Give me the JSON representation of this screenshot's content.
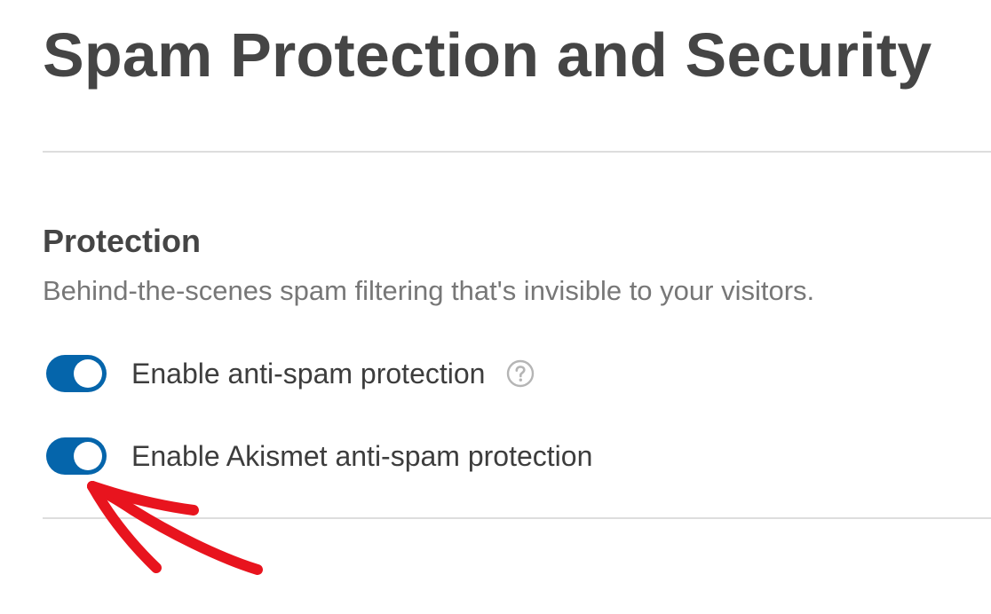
{
  "page": {
    "title": "Spam Protection and Security"
  },
  "protection": {
    "heading": "Protection",
    "description": "Behind-the-scenes spam filtering that's invisible to your visitors.",
    "settings": [
      {
        "label": "Enable anti-spam protection",
        "enabled": true,
        "help_icon": "question-circle-icon"
      },
      {
        "label": "Enable Akismet anti-spam protection",
        "enabled": true
      }
    ]
  },
  "colors": {
    "toggle_on": "#0565ab",
    "annotation_arrow": "#e8141e"
  }
}
